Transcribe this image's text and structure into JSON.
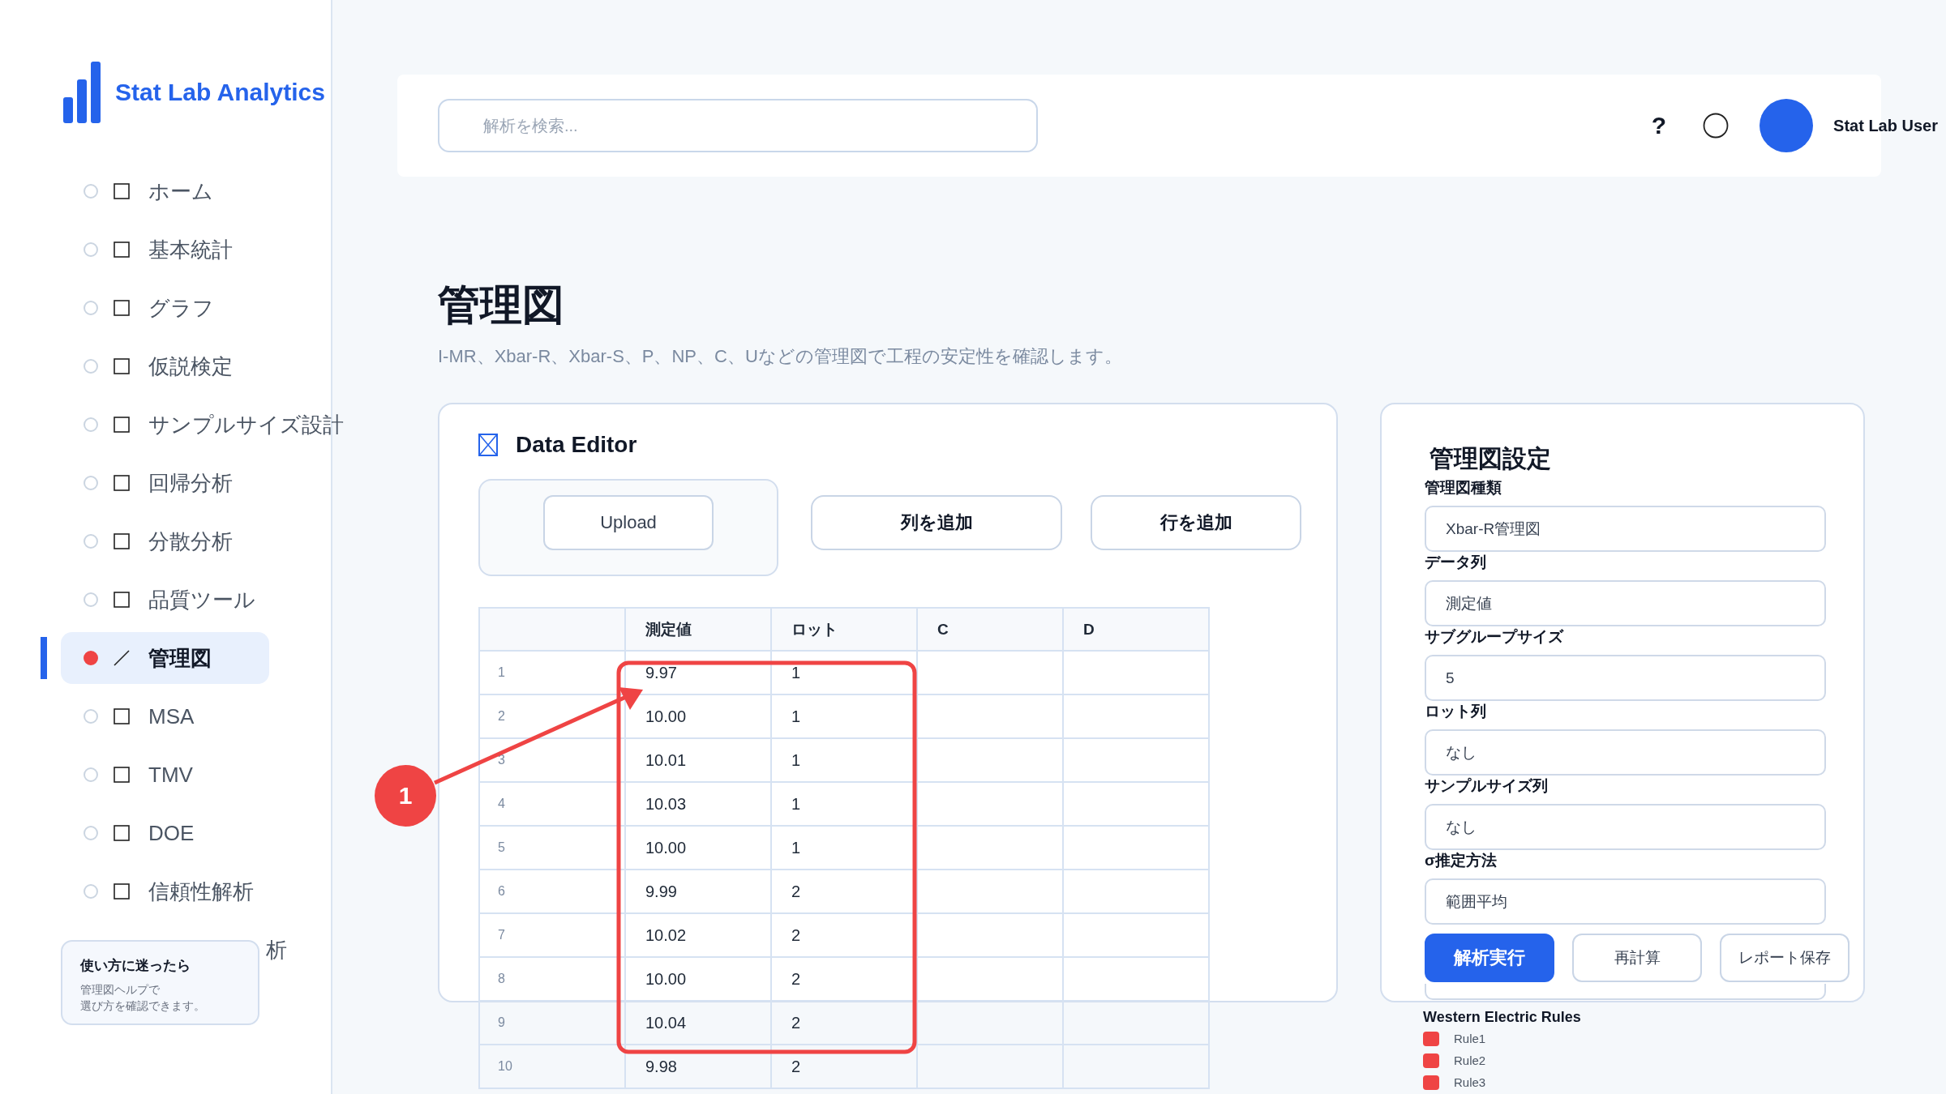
{
  "brand": {
    "name": "Stat Lab Analytics"
  },
  "nav": [
    {
      "kind": "item",
      "label": "ホーム",
      "selected": false
    },
    {
      "kind": "item",
      "label": "基本統計",
      "selected": false
    },
    {
      "kind": "item",
      "label": "グラフ",
      "selected": false
    },
    {
      "kind": "item",
      "label": "仮説検定",
      "selected": false
    },
    {
      "kind": "item",
      "label": "サンプルサイズ設計",
      "selected": false
    },
    {
      "kind": "item",
      "label": "回帰分析",
      "selected": false
    },
    {
      "kind": "item",
      "label": "分散分析",
      "selected": false
    },
    {
      "kind": "item",
      "label": "品質ツール",
      "selected": false
    },
    {
      "kind": "item",
      "label": "管理図",
      "selected": true
    },
    {
      "kind": "item",
      "label": "MSA",
      "selected": false
    },
    {
      "kind": "item",
      "label": "TMV",
      "selected": false
    },
    {
      "kind": "item",
      "label": "DOE",
      "selected": false
    },
    {
      "kind": "item",
      "label": "信頼性解析",
      "selected": false
    },
    {
      "kind": "partial",
      "label": "析",
      "selected": false
    }
  ],
  "help_card": {
    "title": "使い方に迷ったら",
    "lines": [
      "管理図ヘルプで",
      "選び方を確認できます。"
    ]
  },
  "search": {
    "placeholder": "解析を検索..."
  },
  "header": {
    "help": "?",
    "user": "Stat Lab User"
  },
  "page": {
    "title": "管理図",
    "subtitle": "I-MR、Xbar-R、Xbar-S、P、NP、C、Uなどの管理図で工程の安定性を確認します。"
  },
  "data_editor": {
    "title": "Data Editor",
    "upload": "Upload",
    "buttons": [
      "列を追加",
      "行を追加"
    ],
    "table": {
      "columns": [
        "測定値",
        "ロット",
        "C",
        "D"
      ],
      "rows": [
        {
          "index": "1",
          "cells": [
            "9.97",
            "1"
          ]
        },
        {
          "index": "2",
          "cells": [
            "10.00",
            "1"
          ]
        },
        {
          "index": "3",
          "cells": [
            "10.01",
            "1"
          ]
        },
        {
          "index": "4",
          "cells": [
            "10.03",
            "1"
          ]
        },
        {
          "index": "5",
          "cells": [
            "10.00",
            "1"
          ]
        },
        {
          "index": "6",
          "cells": [
            "9.99",
            "2"
          ]
        },
        {
          "index": "7",
          "cells": [
            "10.02",
            "2"
          ]
        },
        {
          "index": "8",
          "cells": [
            "10.00",
            "2"
          ]
        },
        {
          "index": "9",
          "cells": [
            "10.04",
            "2"
          ]
        },
        {
          "index": "10",
          "cells": [
            "9.98",
            "2"
          ]
        }
      ]
    }
  },
  "annotation": {
    "number": "1"
  },
  "settings": {
    "title": "管理図設定",
    "fields": [
      {
        "label": "管理図種類",
        "value": "Xbar-R管理図"
      },
      {
        "label": "データ列",
        "value": "測定値"
      },
      {
        "label": "サブグループサイズ",
        "value": "5"
      },
      {
        "label": "ロット列",
        "value": "なし"
      },
      {
        "label": "サンプルサイズ列",
        "value": "なし"
      },
      {
        "label": "σ推定方法",
        "value": "範囲平均"
      }
    ],
    "actions": [
      {
        "label": "解析実行",
        "kind": "primary"
      },
      {
        "label": "再計算",
        "kind": "secondary"
      },
      {
        "label": "レポート保存",
        "kind": "secondary"
      }
    ]
  },
  "rules": {
    "title": "Western Electric Rules",
    "items": [
      {
        "label": "Rule1",
        "color": "#ef4444"
      },
      {
        "label": "Rule2",
        "color": "#ef4444"
      },
      {
        "label": "Rule3",
        "color": "#ef4444"
      }
    ]
  }
}
